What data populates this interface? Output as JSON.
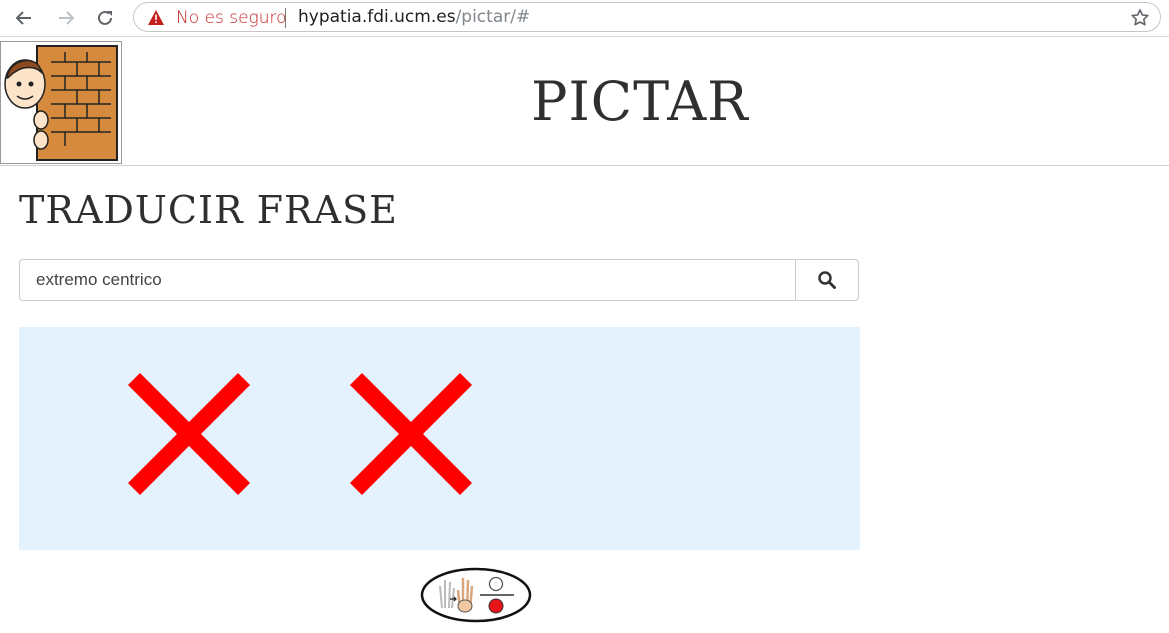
{
  "browser": {
    "security_label": "No es seguro",
    "url_host": "hypatia.fdi.ucm.es",
    "url_path": "/pictar/#",
    "icons": [
      "back-arrow-icon",
      "forward-arrow-icon",
      "reload-icon",
      "warning-icon",
      "star-icon"
    ]
  },
  "header": {
    "title": "PICTAR",
    "logo_icon": "boy-behind-brick-wall-icon"
  },
  "main": {
    "section_title": "TRADUCIR FRASE",
    "search": {
      "value": "extremo centrico",
      "button_icon": "search-icon"
    },
    "results": [
      {
        "icon": "red-x-icon",
        "color": "#ff0000"
      },
      {
        "icon": "red-x-icon",
        "color": "#ff0000"
      }
    ],
    "results_background": "#e3f2fc"
  },
  "footer": {
    "logo_icon": "hand-sign-logo-icon"
  }
}
